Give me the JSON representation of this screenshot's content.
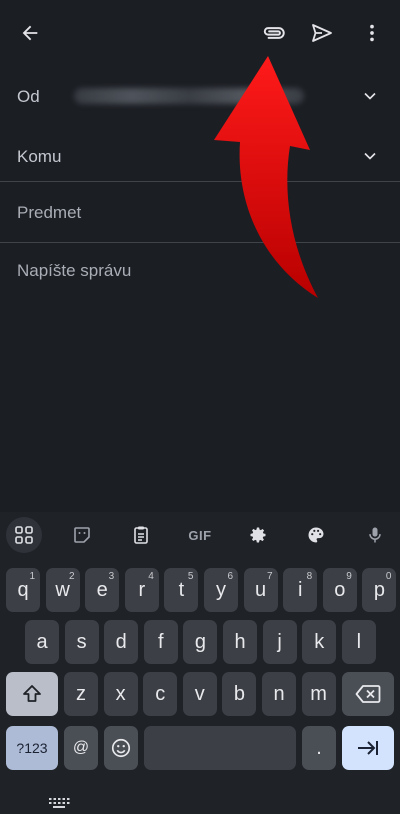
{
  "appbar": {
    "back_icon": "arrow-left-icon",
    "attach_icon": "paperclip-icon",
    "send_icon": "send-icon",
    "more_icon": "more-vert-icon"
  },
  "compose": {
    "from_label": "Od",
    "to_label": "Komu",
    "subject_placeholder": "Predmet",
    "body_placeholder": "Napíšte správu"
  },
  "keyboard": {
    "toolbar": {
      "apps_icon": "grid-icon",
      "sticker_icon": "sticker-icon",
      "clipboard_icon": "clipboard-icon",
      "gif_label": "GIF",
      "settings_icon": "gear-icon",
      "theme_icon": "palette-icon",
      "mic_icon": "mic-icon"
    },
    "row1": [
      {
        "k": "q",
        "n": "1"
      },
      {
        "k": "w",
        "n": "2"
      },
      {
        "k": "e",
        "n": "3"
      },
      {
        "k": "r",
        "n": "4"
      },
      {
        "k": "t",
        "n": "5"
      },
      {
        "k": "y",
        "n": "6"
      },
      {
        "k": "u",
        "n": "7"
      },
      {
        "k": "i",
        "n": "8"
      },
      {
        "k": "o",
        "n": "9"
      },
      {
        "k": "p",
        "n": "0"
      }
    ],
    "row2": [
      "a",
      "s",
      "d",
      "f",
      "g",
      "h",
      "j",
      "k",
      "l"
    ],
    "row3": [
      "z",
      "x",
      "c",
      "v",
      "b",
      "n",
      "m"
    ],
    "sym_label": "?123",
    "at_label": "@",
    "period_label": "."
  },
  "colors": {
    "background": "#1b1e23",
    "annotation_arrow": "#e00000",
    "enter_key": "#d3e3fd"
  }
}
